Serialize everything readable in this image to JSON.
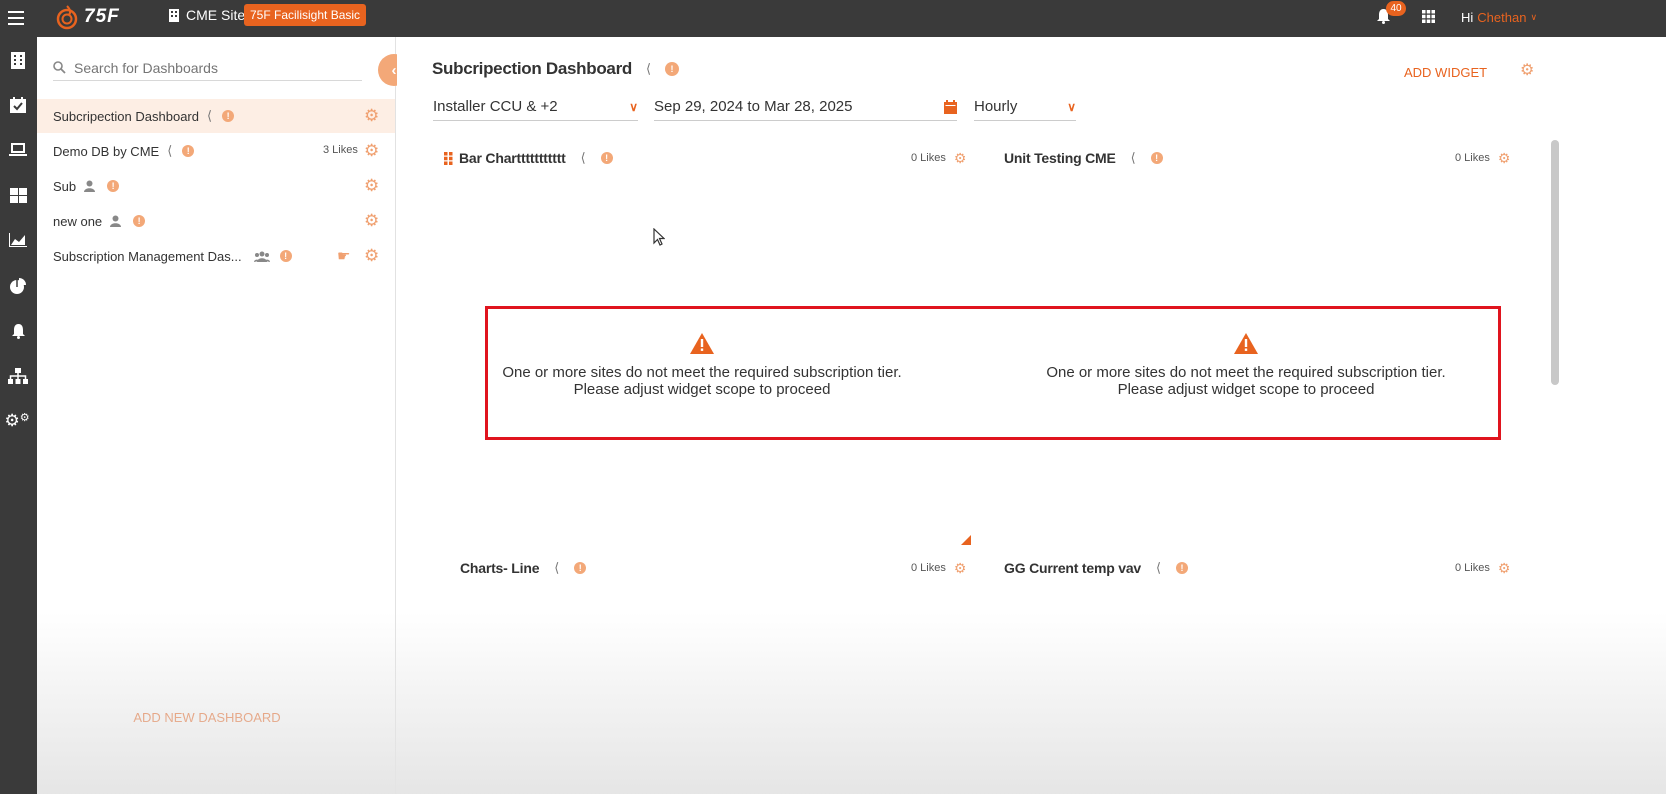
{
  "topbar": {
    "brand": "75F",
    "site": "CME Site",
    "plan_badge": "75F Facilisight Basic",
    "notification_count": "40",
    "greeting": "Hi",
    "user_name": "Chethan"
  },
  "leftnav": {
    "icons": [
      "building-icon",
      "calendar-icon",
      "monitor-icon",
      "dashboard-icon",
      "chart-icon",
      "pie-icon",
      "bell-icon",
      "hierarchy-icon",
      "settings-icon"
    ]
  },
  "sidebar": {
    "search_placeholder": "Search for Dashboards",
    "items": [
      {
        "label": "Subcripection Dashboard",
        "likes": "",
        "type": "shared"
      },
      {
        "label": "Demo DB by CME",
        "likes": "3 Likes",
        "type": "shared"
      },
      {
        "label": "Sub",
        "likes": "",
        "type": "private"
      },
      {
        "label": "new one",
        "likes": "",
        "type": "private"
      },
      {
        "label": "Subscription Management Das...",
        "likes": "",
        "type": "group"
      }
    ],
    "add_new_label": "ADD NEW DASHBOARD"
  },
  "main": {
    "title": "Subcripection Dashboard",
    "add_widget_label": "ADD WIDGET",
    "filters": {
      "scope": "Installer CCU & +2",
      "date_range": "Sep 29, 2024 to Mar 28, 2025",
      "interval": "Hourly"
    },
    "widgets": [
      {
        "title": "Bar Charttttttttttt",
        "likes": "0 Likes"
      },
      {
        "title": "Unit Testing CME",
        "likes": "0 Likes"
      },
      {
        "title": "Charts- Line",
        "likes": "0 Likes"
      },
      {
        "title": "GG Current temp vav",
        "likes": "0 Likes"
      }
    ],
    "warning": {
      "line1": "One or more sites do not meet the required subscription tier.",
      "line2": "Please adjust widget scope to proceed"
    }
  },
  "colors": {
    "accent": "#e8631f",
    "accent_light": "#f0a070",
    "nav_bg": "#3a3a3a",
    "highlight_border": "#e0141e"
  }
}
